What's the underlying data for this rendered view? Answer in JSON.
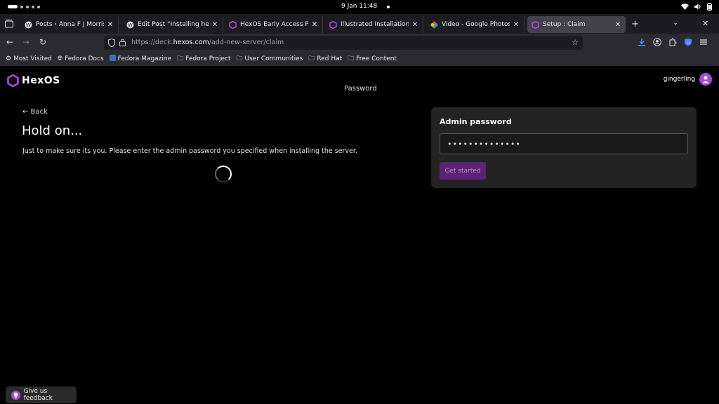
{
  "system": {
    "clock": "9 Jan  11:48",
    "icons": [
      "wifi-icon",
      "volume-icon",
      "battery-icon"
    ]
  },
  "tabs": [
    {
      "title": "Posts ‹ Anna F J Morris —",
      "icon": "wordpress-icon",
      "active": false
    },
    {
      "title": "Edit Post “Installing hex",
      "icon": "wordpress-icon",
      "active": false
    },
    {
      "title": "HexOS Early Access Pr",
      "icon": "hexos-icon",
      "active": false
    },
    {
      "title": "Illustrated Installation G",
      "icon": "hexos-icon",
      "active": false
    },
    {
      "title": "Video - Google Photos",
      "icon": "google-photos-icon",
      "active": false
    },
    {
      "title": "Setup : Claim",
      "icon": "hexos-icon",
      "active": true
    }
  ],
  "nav": {
    "url_prefix": "https://deck.",
    "url_domain": "hexos.com",
    "url_path": "/add-new-server/claim"
  },
  "bookmarks": [
    {
      "label": "Most Visited",
      "icon": "gear-icon"
    },
    {
      "label": "Fedora Docs",
      "icon": "globe-icon"
    },
    {
      "label": "Fedora Magazine",
      "icon": "fedora-icon"
    },
    {
      "label": "Fedora Project",
      "icon": "folder-icon"
    },
    {
      "label": "User Communities",
      "icon": "folder-icon"
    },
    {
      "label": "Red Hat",
      "icon": "folder-icon"
    },
    {
      "label": "Free Content",
      "icon": "folder-icon"
    }
  ],
  "page": {
    "logo": "HexOS",
    "username": "gingerling",
    "step_label": "Password",
    "back": "← Back",
    "heading": "Hold on...",
    "description": "Just to make sure its you. Please enter the admin password you specified when installing the server.",
    "card_title": "Admin password",
    "password_value": "••••••••••••••",
    "submit_label": "Get started",
    "feedback_label": "Give us feedback"
  },
  "colors": {
    "accent": "#a64cd6",
    "button": "#5b2373",
    "card": "#232323"
  }
}
